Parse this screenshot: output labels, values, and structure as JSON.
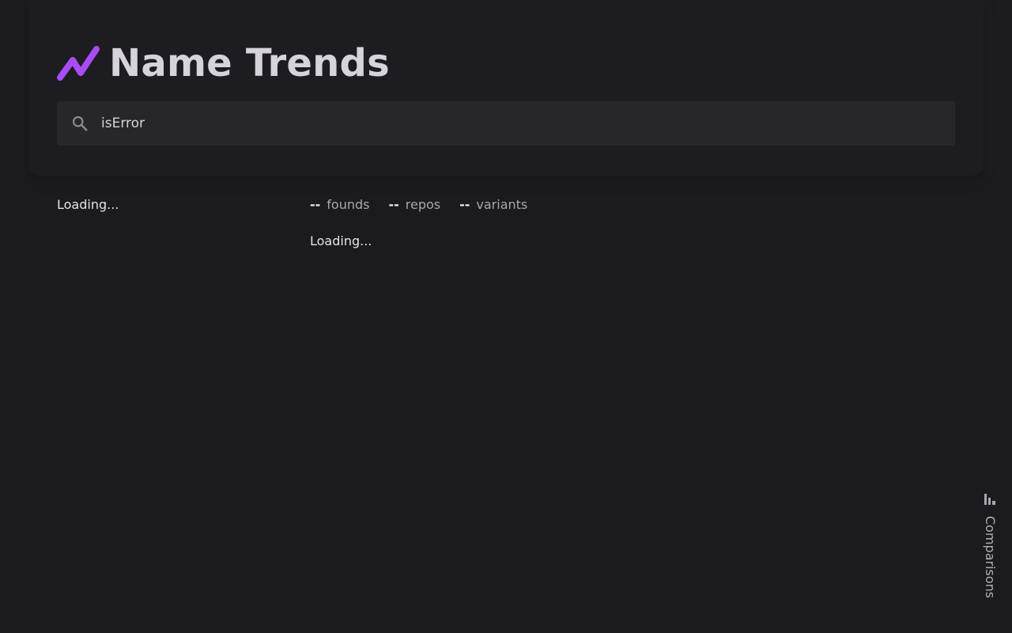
{
  "app": {
    "title": "Name Trends",
    "accent_color": "#a94cf7",
    "logo_icon": "trend-line-icon"
  },
  "search": {
    "value": "isError",
    "icon": "search-icon"
  },
  "results": {
    "left_status": "Loading...",
    "stats": [
      {
        "value": "--",
        "label": "founds"
      },
      {
        "value": "--",
        "label": "repos"
      },
      {
        "value": "--",
        "label": "variants"
      }
    ],
    "right_status": "Loading..."
  },
  "comparisons": {
    "label": "Comparisons",
    "icon": "comparison-bars-icon"
  }
}
